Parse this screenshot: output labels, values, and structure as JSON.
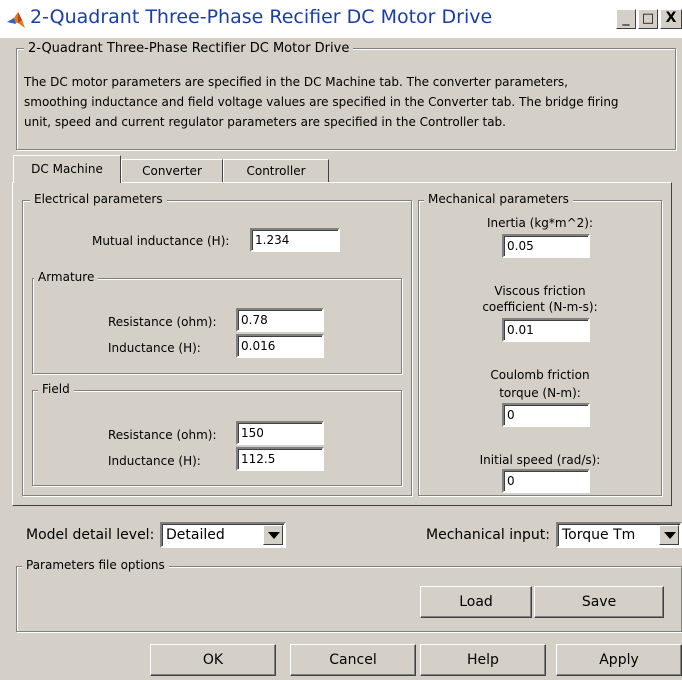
{
  "window": {
    "title": "2-Quadrant Three-Phase Recifier DC Motor Drive",
    "icon": "matlab-logo-icon",
    "minimize_glyph": "_",
    "maximize_glyph": "□",
    "close_glyph": "X"
  },
  "block": {
    "group_title": "2-Quadrant Three-Phase Rectifier DC Motor Drive",
    "description_lines": [
      "The DC motor parameters are specified in the DC Machine tab. The converter parameters,",
      "smoothing inductance and field voltage values are specified in the Converter tab. The bridge firing",
      "unit, speed and current regulator parameters are specified in the Controller tab."
    ]
  },
  "tabs": [
    {
      "label": "DC Machine",
      "active": true
    },
    {
      "label": "Converter",
      "active": false
    },
    {
      "label": "Controller",
      "active": false
    }
  ],
  "electrical": {
    "title": "Electrical parameters",
    "mutual_inductance": {
      "label": "Mutual inductance (H):",
      "value": "1.234"
    },
    "armature": {
      "title": "Armature",
      "resistance": {
        "label": "Resistance (ohm):",
        "value": "0.78"
      },
      "inductance": {
        "label": "Inductance (H):",
        "value": "0.016"
      }
    },
    "field": {
      "title": "Field",
      "resistance": {
        "label": "Resistance (ohm):",
        "value": "150"
      },
      "inductance": {
        "label": "Inductance (H):",
        "value": "112.5"
      }
    }
  },
  "mechanical": {
    "title": "Mechanical parameters",
    "inertia": {
      "label": "Inertia (kg*m^2):",
      "value": "0.05"
    },
    "viscous": {
      "label_1": "Viscous friction",
      "label_2": "coefficient (N-m-s):",
      "value": "0.01"
    },
    "coulomb": {
      "label_1": "Coulomb friction",
      "label_2": "torque (N-m):",
      "value": "0"
    },
    "initial_speed": {
      "label": "Initial speed (rad/s):",
      "value": "0"
    }
  },
  "model_detail": {
    "label": "Model detail level:",
    "value": "Detailed"
  },
  "mechanical_input": {
    "label": "Mechanical input:",
    "value": "Torque Tm"
  },
  "params_file": {
    "title": "Parameters file options",
    "load_label": "Load",
    "save_label": "Save"
  },
  "footer": {
    "ok_label": "OK",
    "cancel_label": "Cancel",
    "help_label": "Help",
    "apply_label": "Apply"
  }
}
